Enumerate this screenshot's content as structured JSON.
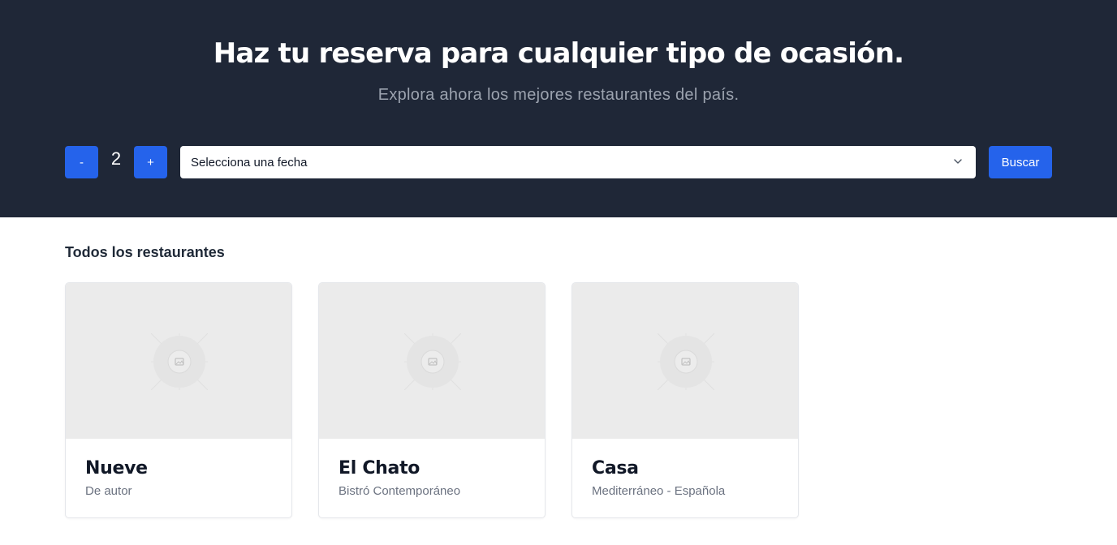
{
  "hero": {
    "title": "Haz tu reserva para cualquier tipo de ocasión.",
    "subtitle": "Explora ahora los mejores restaurantes del país."
  },
  "search": {
    "minus_label": "-",
    "plus_label": "+",
    "guests": "2",
    "date_placeholder": "Selecciona una fecha",
    "search_label": "Buscar"
  },
  "section": {
    "title": "Todos los restaurantes"
  },
  "restaurants": [
    {
      "name": "Nueve",
      "category": "De autor"
    },
    {
      "name": "El Chato",
      "category": "Bistró Contemporáneo"
    },
    {
      "name": "Casa",
      "category": "Mediterráneo - Española"
    }
  ],
  "colors": {
    "hero_bg": "#1f2737",
    "accent": "#2563eb",
    "placeholder_bg": "#ebebeb"
  }
}
